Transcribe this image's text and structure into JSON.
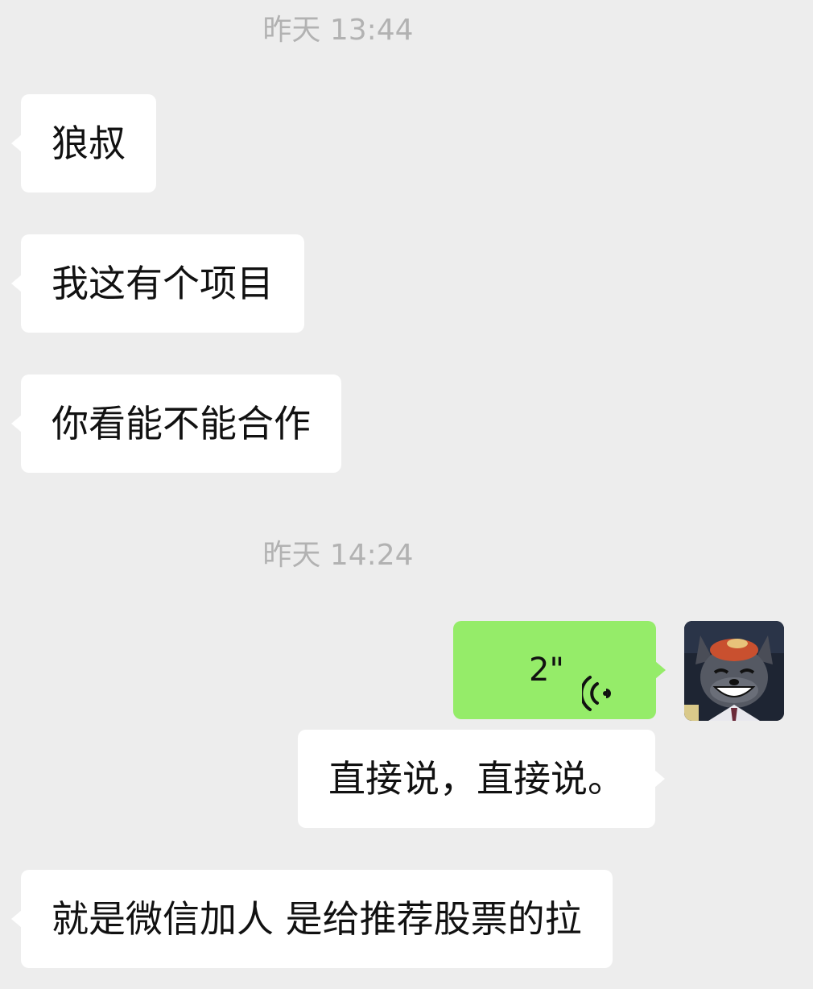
{
  "chat": {
    "timestamps": [
      "昨天 13:44",
      "昨天 14:24"
    ],
    "messages": [
      {
        "side": "left",
        "type": "text",
        "text": "狼叔"
      },
      {
        "side": "left",
        "type": "text",
        "text": "我这有个项目"
      },
      {
        "side": "left",
        "type": "text",
        "text": "你看能不能合作"
      },
      {
        "side": "right",
        "type": "voice",
        "duration": "2\""
      },
      {
        "side": "right",
        "type": "text",
        "text": "直接说，直接说。"
      },
      {
        "side": "left",
        "type": "text",
        "text": "就是微信加人 是给推荐股票的拉"
      }
    ]
  },
  "icons": {
    "voice": "voice-wave-icon",
    "avatar": "wolf-cartoon-avatar"
  },
  "colors": {
    "background": "#ededed",
    "incoming_bubble": "#ffffff",
    "outgoing_voice_bubble": "#95ec69",
    "timestamp_text": "#b2b2b2",
    "message_text": "#111111"
  }
}
